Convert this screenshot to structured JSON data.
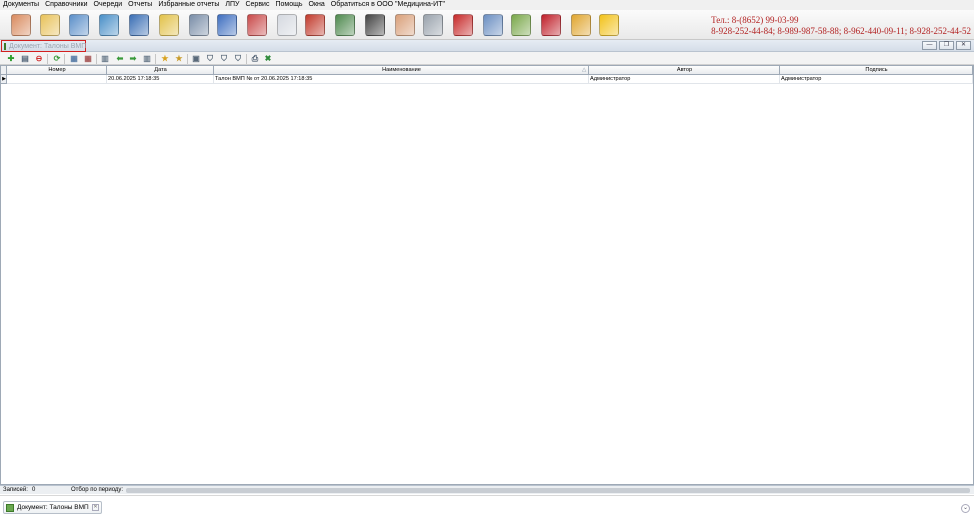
{
  "menu": {
    "items": [
      {
        "label": "Документы"
      },
      {
        "label": "Справочники"
      },
      {
        "label": "Очереди"
      },
      {
        "label": "Отчеты"
      },
      {
        "label": "Избранные отчеты"
      },
      {
        "label": "ЛПУ"
      },
      {
        "label": "Сервис"
      },
      {
        "label": "Помощь"
      },
      {
        "label": "Окна"
      },
      {
        "label": "Обратиться в ООО \"Медицина-ИТ\""
      }
    ]
  },
  "contact": {
    "phone_line1": "Тел.: 8-(8652) 99-03-99",
    "phone_line2": "8-928-252-44-84; 8-989-987-58-88; 8-962-440-09-11; 8-928-252-44-52",
    "color": "#b22222"
  },
  "toolbar_icons": [
    {
      "name": "doctor-icon",
      "color": "#d98b5f"
    },
    {
      "name": "notebook-icon",
      "color": "#e8c25a"
    },
    {
      "name": "cabinet-icon",
      "color": "#5b8fc9"
    },
    {
      "name": "patient-card-icon",
      "color": "#4a90c8"
    },
    {
      "name": "books-icon",
      "color": "#3b6fb5"
    },
    {
      "name": "notepad-pencil-icon",
      "color": "#e2c24a"
    },
    {
      "name": "syringe-icon",
      "color": "#7a8ea8"
    },
    {
      "name": "calendar-book-icon",
      "color": "#3f6fc0"
    },
    {
      "name": "medical-kit-icon",
      "color": "#c94a4a"
    },
    {
      "name": "ampoule-icon",
      "color": "#d5d9e0"
    },
    {
      "name": "pills-box-icon",
      "color": "#c23b2d"
    },
    {
      "name": "capsules-icon",
      "color": "#4f8a4f"
    },
    {
      "name": "barcode-scanner-icon",
      "color": "#444444"
    },
    {
      "name": "nurse-icon",
      "color": "#d9a07a"
    },
    {
      "name": "thermometer-icon",
      "color": "#9aa3ad"
    },
    {
      "name": "red-book-icon",
      "color": "#c72b2b"
    },
    {
      "name": "calendar-clock-icon",
      "color": "#6b8fc2"
    },
    {
      "name": "schedule-icon",
      "color": "#7aa84a"
    },
    {
      "name": "pdf-reader-icon",
      "color": "#c0202a"
    },
    {
      "name": "lock-icon",
      "color": "#e0a630"
    },
    {
      "name": "chat-bubble-icon",
      "color": "#f2c21a"
    }
  ],
  "document_window": {
    "title": "Документ: Талоны ВМП",
    "minimize_label": "—",
    "restore_label": "❐",
    "close_label": "✕"
  },
  "small_toolbar": [
    {
      "name": "add-icon",
      "glyph": "✚",
      "color": "#2f9e2f"
    },
    {
      "name": "edit-icon",
      "glyph": "▤",
      "color": "#55667a"
    },
    {
      "name": "delete-icon",
      "glyph": "⊖",
      "color": "#d12b2b"
    },
    {
      "name": "refresh-icon",
      "glyph": "⟳",
      "color": "#3a9a3a"
    },
    {
      "name": "export-icon",
      "glyph": "▦",
      "color": "#5b7ea8"
    },
    {
      "name": "import-icon",
      "glyph": "▦",
      "color": "#a85b5b"
    },
    {
      "name": "columns-icon",
      "glyph": "▥",
      "color": "#6a7a8a"
    },
    {
      "name": "arrow-left-icon",
      "glyph": "⬅",
      "color": "#3a9a3a"
    },
    {
      "name": "arrow-right-icon",
      "glyph": "➡",
      "color": "#3a9a3a"
    },
    {
      "name": "table-settings-icon",
      "glyph": "▥",
      "color": "#6a7a8a"
    },
    {
      "name": "star-add-icon",
      "glyph": "★",
      "color": "#d9a21e"
    },
    {
      "name": "star-icon",
      "glyph": "★",
      "color": "#c89b2a"
    },
    {
      "name": "calculator-icon",
      "glyph": "▣",
      "color": "#5a6a7a"
    },
    {
      "name": "filter-icon",
      "glyph": "⛉",
      "color": "#5a6a7a"
    },
    {
      "name": "filter-edit-icon",
      "glyph": "⛉",
      "color": "#5a6a7a"
    },
    {
      "name": "filter-clear-icon",
      "glyph": "⛉",
      "color": "#5a6a7a"
    },
    {
      "name": "print-icon",
      "glyph": "⎙",
      "color": "#4d5d70"
    },
    {
      "name": "excel-icon",
      "glyph": "✖",
      "color": "#2f8a3a"
    }
  ],
  "table": {
    "columns": [
      {
        "label": "Номер"
      },
      {
        "label": "Дата"
      },
      {
        "label": "Наименование"
      },
      {
        "label": "Автор"
      },
      {
        "label": "Подпись"
      }
    ],
    "rows": [
      {
        "indicator": "▶",
        "cells": [
          "",
          "20.06.2025 17:18:35",
          "Талон ВМП № от 20.06.2025 17:18:35",
          "Администратор",
          "Администратор"
        ]
      }
    ],
    "sort_indicator": "△"
  },
  "status": {
    "records_label": "Записей:",
    "records_value": "0",
    "period_label": "Отбор по периоду:"
  },
  "taskbar": {
    "tab_label": "Документ: Талоны ВМП",
    "tab_close": "✕",
    "chevron": "⌄"
  }
}
